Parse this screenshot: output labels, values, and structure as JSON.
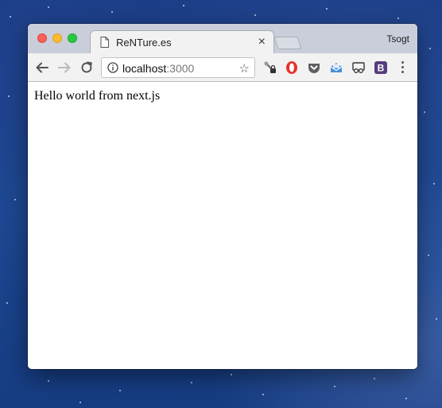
{
  "browser": {
    "tab": {
      "title": "ReNTure.es"
    },
    "profile_name": "Tsogt",
    "address_bar": {
      "host": "localhost",
      "port": ":3000"
    },
    "extensions": [
      "key-lock-icon",
      "opera-o-icon",
      "pocket-icon",
      "mail-icon",
      "cast-glasses-icon",
      "bootstrap-b-icon"
    ]
  },
  "page": {
    "body_text": "Hello world from next.js"
  },
  "colors": {
    "desktop_blue": "#1c4892",
    "tab_bar": "#c9ceda",
    "toolbar": "#f2f2f2"
  }
}
